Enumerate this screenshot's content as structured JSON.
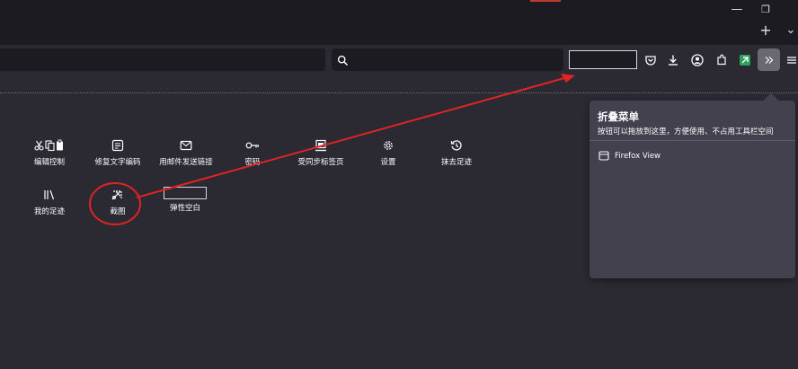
{
  "window": {
    "minimize_glyph": "—",
    "restore_glyph": "❐",
    "new_tab_glyph": "+",
    "list_tabs_glyph": "⌄"
  },
  "toolbar": {
    "icons": [
      "search-icon",
      "pocket-icon",
      "downloads-icon",
      "account-icon",
      "extensions-icon",
      "green-extension-icon",
      "overflow-chevron-icon",
      "menu-icon"
    ]
  },
  "palette": {
    "items": [
      {
        "label": "编辑控制",
        "icon": "cut-copy-paste-icon"
      },
      {
        "label": "修复文字编码",
        "icon": "text-encoding-icon"
      },
      {
        "label": "用邮件发送链接",
        "icon": "email-icon"
      },
      {
        "label": "密码",
        "icon": "key-icon"
      },
      {
        "label": "受同步标签页",
        "icon": "synced-tabs-icon"
      },
      {
        "label": "设置",
        "icon": "gear-icon"
      },
      {
        "label": "抹去足迹",
        "icon": "history-clear-icon"
      },
      {
        "label": "我的足迹",
        "icon": "library-icon"
      },
      {
        "label": "截图",
        "icon": "screenshot-icon"
      },
      {
        "label": "弹性空白",
        "icon": "flexible-space"
      }
    ]
  },
  "overflow_panel": {
    "title": "折叠菜单",
    "description": "按钮可以拖放到这里，方便使用、不占用工具栏空间",
    "items": [
      {
        "label": "Firefox View",
        "icon": "firefox-view-icon"
      }
    ]
  },
  "annotations": {
    "arrow_color": "#e02424",
    "circle_color": "#e02424"
  },
  "colors": {
    "background": "#2b2a33",
    "titlebar": "#1c1b22",
    "panel": "#42414d",
    "text": "#fbfbfe",
    "accent_green": "#2aa35a"
  }
}
